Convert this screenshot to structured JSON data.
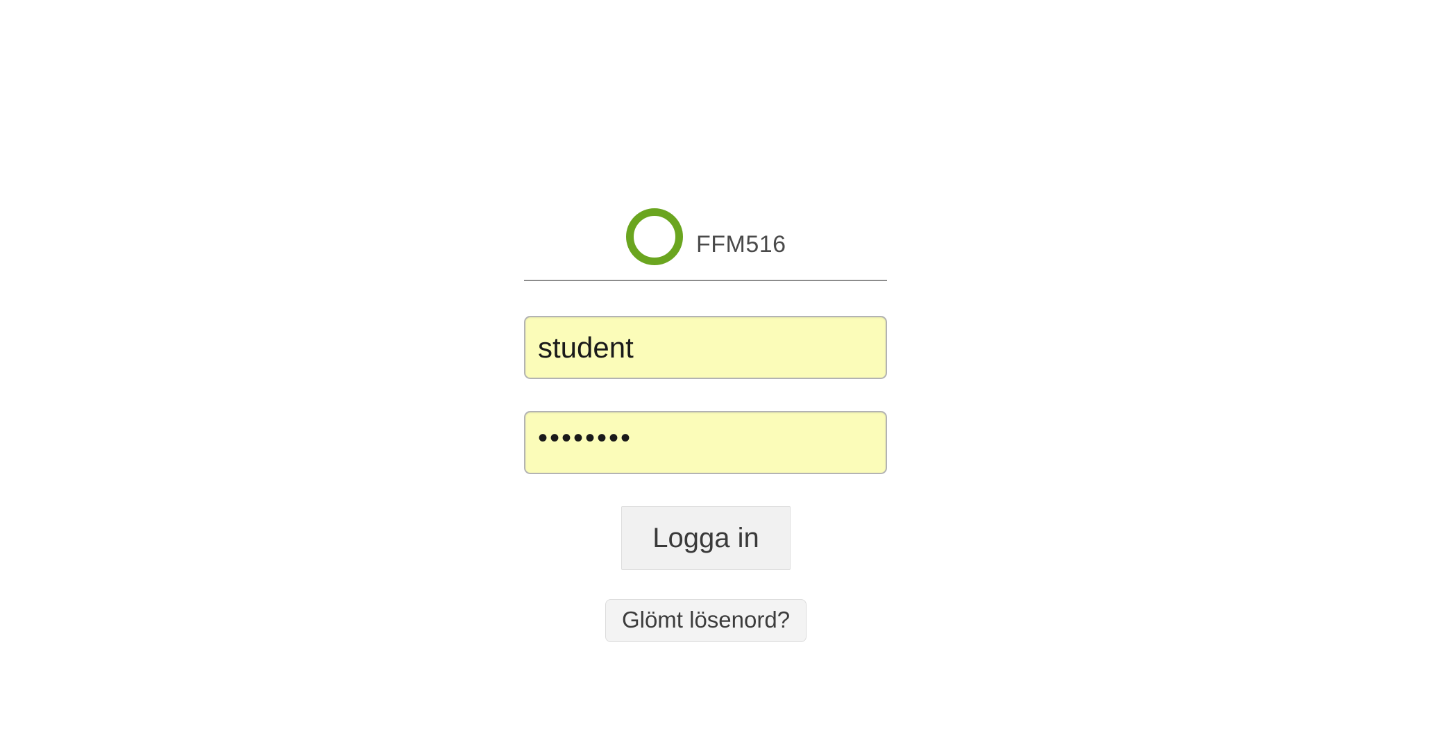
{
  "brand": {
    "logo_icon": "green-ring-logo-icon",
    "accent_color": "#6aa51f",
    "name": "FFM516"
  },
  "login_form": {
    "username_value": "student",
    "password_masked": "••••••••",
    "field_background": "#fbfcb9",
    "login_label": "Logga in",
    "forgot_label": "Glömt lösenord?"
  }
}
